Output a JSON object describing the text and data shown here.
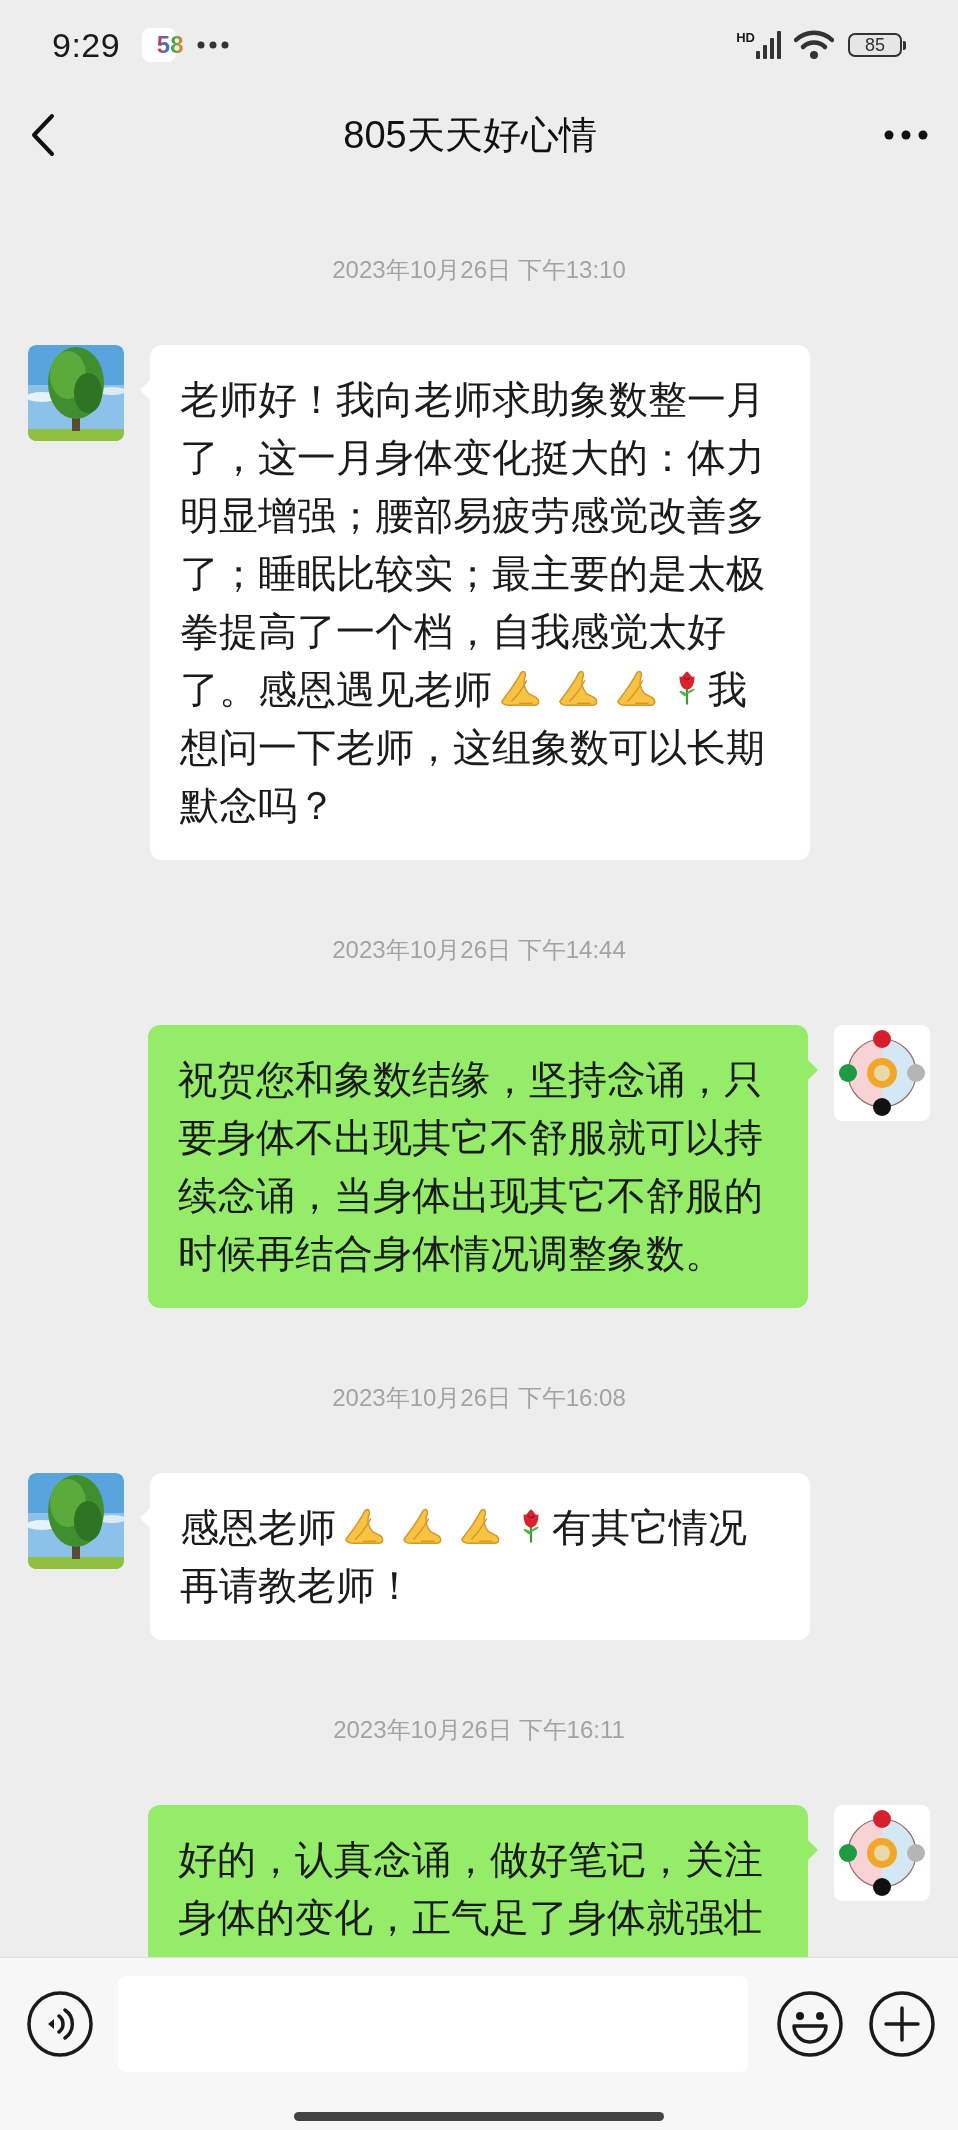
{
  "status_bar": {
    "time": "9:29",
    "app_badge": "58",
    "network_label": "HD",
    "battery": "85"
  },
  "header": {
    "title": "805天天好心情"
  },
  "messages": [
    {
      "kind": "timestamp",
      "text": "2023年10月26日 下午13:10"
    },
    {
      "kind": "incoming",
      "parts": [
        {
          "kind": "text",
          "text": "老师好！我向老师求助象数整一月了，这一月身体变化挺大的：体力明显增强；腰部易疲劳感觉改善多了；睡眠比较实；最主要的是太极拳提高了一个档，自我感觉太好了。感恩遇见老师"
        },
        {
          "kind": "pray"
        },
        {
          "kind": "pray"
        },
        {
          "kind": "pray"
        },
        {
          "kind": "rose"
        },
        {
          "kind": "text",
          "text": "我想问一下老师，这组象数可以长期默念吗？"
        }
      ]
    },
    {
      "kind": "timestamp",
      "text": "2023年10月26日 下午14:44"
    },
    {
      "kind": "outgoing",
      "parts": [
        {
          "kind": "text",
          "text": "祝贺您和象数结缘，坚持念诵，只要身体不出现其它不舒服就可以持续念诵，当身体出现其它不舒服的时候再结合身体情况调整象数。"
        }
      ]
    },
    {
      "kind": "timestamp",
      "text": "2023年10月26日 下午16:08"
    },
    {
      "kind": "incoming",
      "parts": [
        {
          "kind": "text",
          "text": "感恩老师"
        },
        {
          "kind": "pray"
        },
        {
          "kind": "pray"
        },
        {
          "kind": "pray"
        },
        {
          "kind": "rose"
        },
        {
          "kind": "text",
          "text": "有其它情况再请教老师！"
        }
      ]
    },
    {
      "kind": "timestamp",
      "text": "2023年10月26日 下午16:11"
    },
    {
      "kind": "outgoing",
      "parts": [
        {
          "kind": "text",
          "text": "好的，认真念诵，做好笔记，关注身体的变化，正气足了身体就强壮"
        }
      ]
    }
  ]
}
